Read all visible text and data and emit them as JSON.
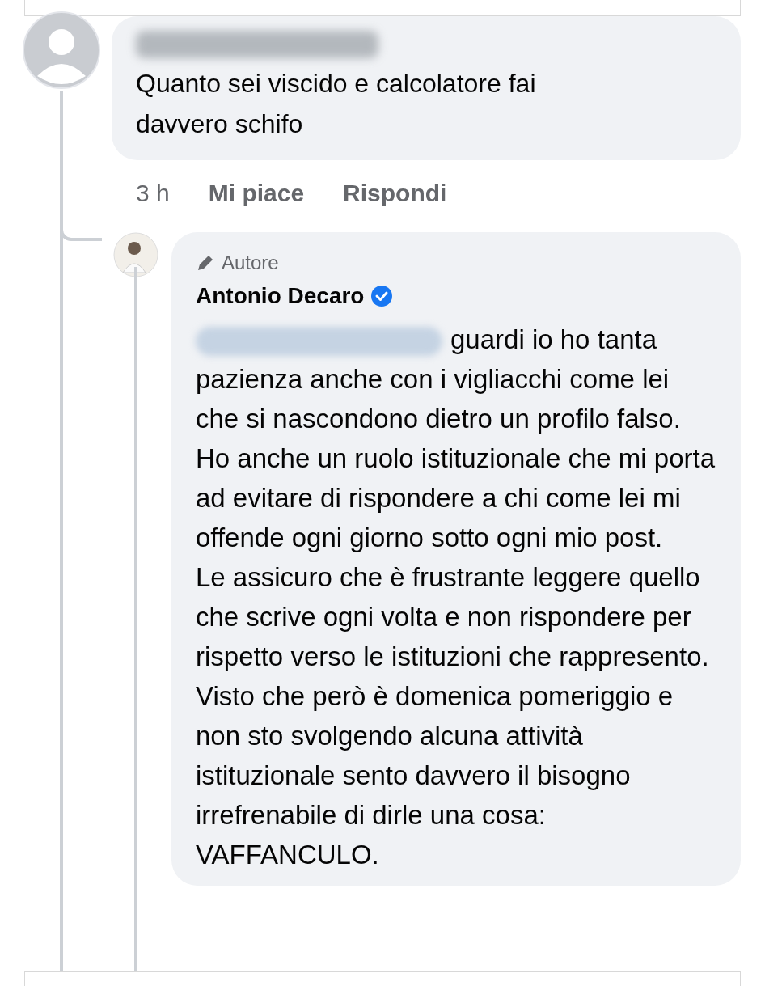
{
  "comment": {
    "author_redacted": true,
    "text": "Quanto sei viscido e calcolatore fai davvero schifo",
    "time": "3 h",
    "actions": [
      "Mi piace",
      "Rispondi"
    ]
  },
  "reply": {
    "badge": "Autore",
    "author": "Antonio Decaro",
    "verified": true,
    "mention_redacted": true,
    "text": "guardi io ho tanta pazienza anche con i vigliacchi come lei che si nascondono dietro un profilo falso.\nHo anche un ruolo istituzionale che mi porta ad evitare di rispondere a chi come lei mi offende ogni giorno sotto ogni mio post.\nLe assicuro che è frustrante leggere quello che scrive ogni volta e non rispondere per rispetto verso le istituzioni che rappresento.\nVisto che però è domenica pomeriggio e non sto svolgendo alcuna attività istituzionale sento davvero il bisogno irrefrenabile di dirle una cosa: VAFFANCULO."
  }
}
